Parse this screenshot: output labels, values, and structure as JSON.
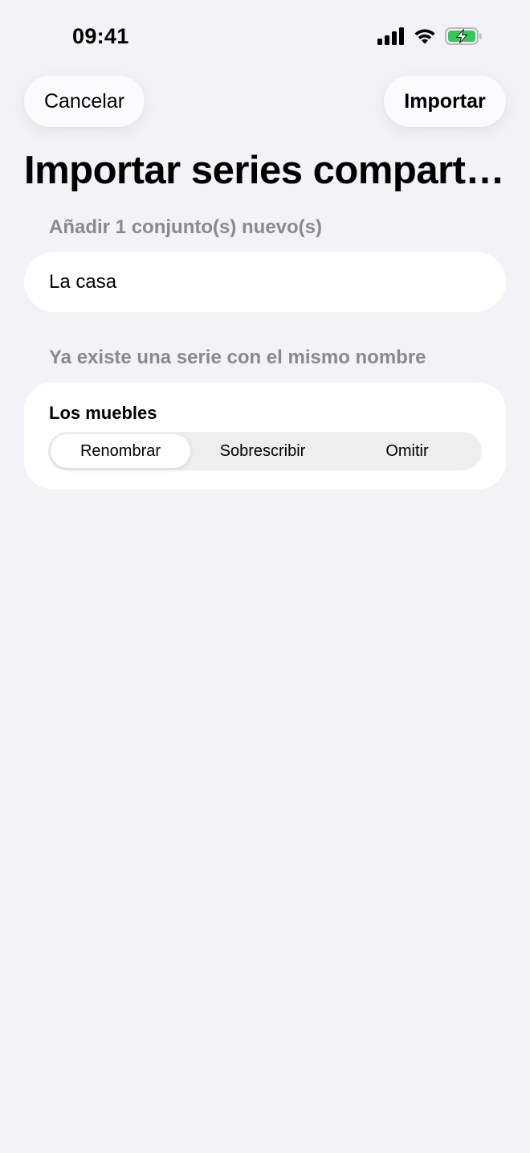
{
  "status_bar": {
    "time": "09:41",
    "icons": [
      "cellular-signal-icon",
      "wifi-icon",
      "battery-charging-icon"
    ],
    "battery_color": "#34c759"
  },
  "nav": {
    "cancel_label": "Cancelar",
    "import_label": "Importar"
  },
  "title": "Importar series compartidas",
  "new_section": {
    "header": "Añadir 1 conjunto(s) nuevo(s)",
    "items": [
      "La casa"
    ]
  },
  "existing_section": {
    "header": "Ya existe una serie con el mismo nombre",
    "items": [
      {
        "name": "Los muebles",
        "options": [
          "Renombrar",
          "Sobrescribir",
          "Omitir"
        ],
        "selected": "Renombrar"
      }
    ]
  },
  "colors": {
    "background": "#f2f2f7",
    "secondary_text": "#8a8a8e",
    "card": "#ffffff"
  }
}
